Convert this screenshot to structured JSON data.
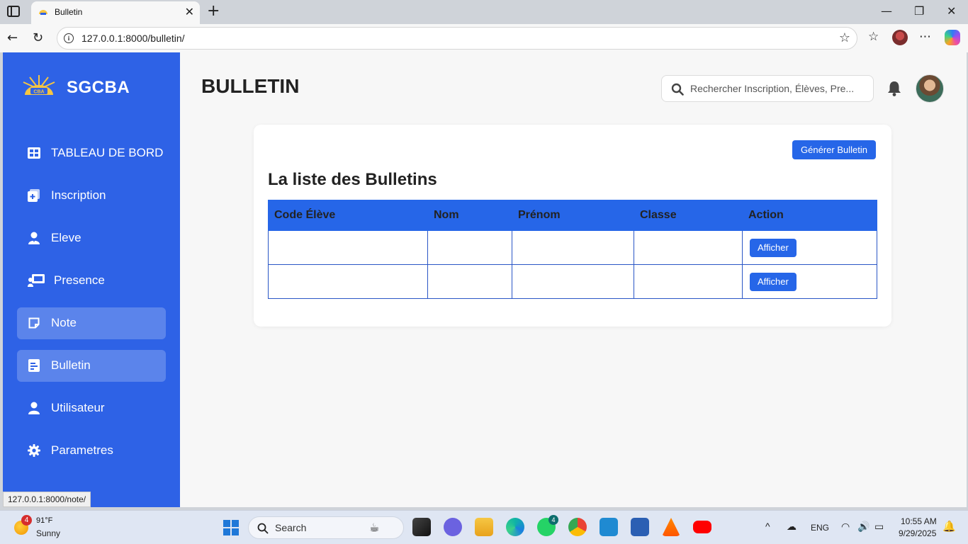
{
  "browser": {
    "tab_title": "Bulletin",
    "url": "127.0.0.1:8000/bulletin/",
    "status_url": "127.0.0.1:8000/note/"
  },
  "sidebar": {
    "brand": "SGCBA",
    "logo_text": "CBA",
    "active_color": "#4f7ae9",
    "items": [
      {
        "label": "TABLEAU DE BORD",
        "icon": "dashboard-grid-icon"
      },
      {
        "label": "Inscription",
        "icon": "add-file-icon"
      },
      {
        "label": "Eleve",
        "icon": "student-icon"
      },
      {
        "label": "Presence",
        "icon": "presentation-icon"
      },
      {
        "label": "Note",
        "icon": "note-icon"
      },
      {
        "label": "Bulletin",
        "icon": "document-lines-icon"
      },
      {
        "label": "Utilisateur",
        "icon": "user-icon"
      },
      {
        "label": "Parametres",
        "icon": "gear-icon"
      }
    ]
  },
  "header": {
    "title": "BULLETIN",
    "search_placeholder": "Rechercher Inscription, Élèves, Pre..."
  },
  "main": {
    "generate_button": "Générer Bulletin",
    "list_title": "La liste des Bulletins",
    "columns": [
      "Code Élève",
      "Nom",
      "Prénom",
      "Classe",
      "Action"
    ],
    "rows": [
      {
        "code": "",
        "nom": "",
        "prenom": "",
        "classe": "",
        "action": "Afficher"
      },
      {
        "code": "",
        "nom": "",
        "prenom": "",
        "classe": "",
        "action": "Afficher"
      }
    ],
    "accent_color": "#2666e8"
  },
  "taskbar": {
    "weather_temp": "91°F",
    "weather_condition": "Sunny",
    "weather_badge": "4",
    "search_label": "Search",
    "whatsapp_badge": "4",
    "language": "ENG",
    "time": "10:55 AM",
    "date": "9/29/2025"
  }
}
